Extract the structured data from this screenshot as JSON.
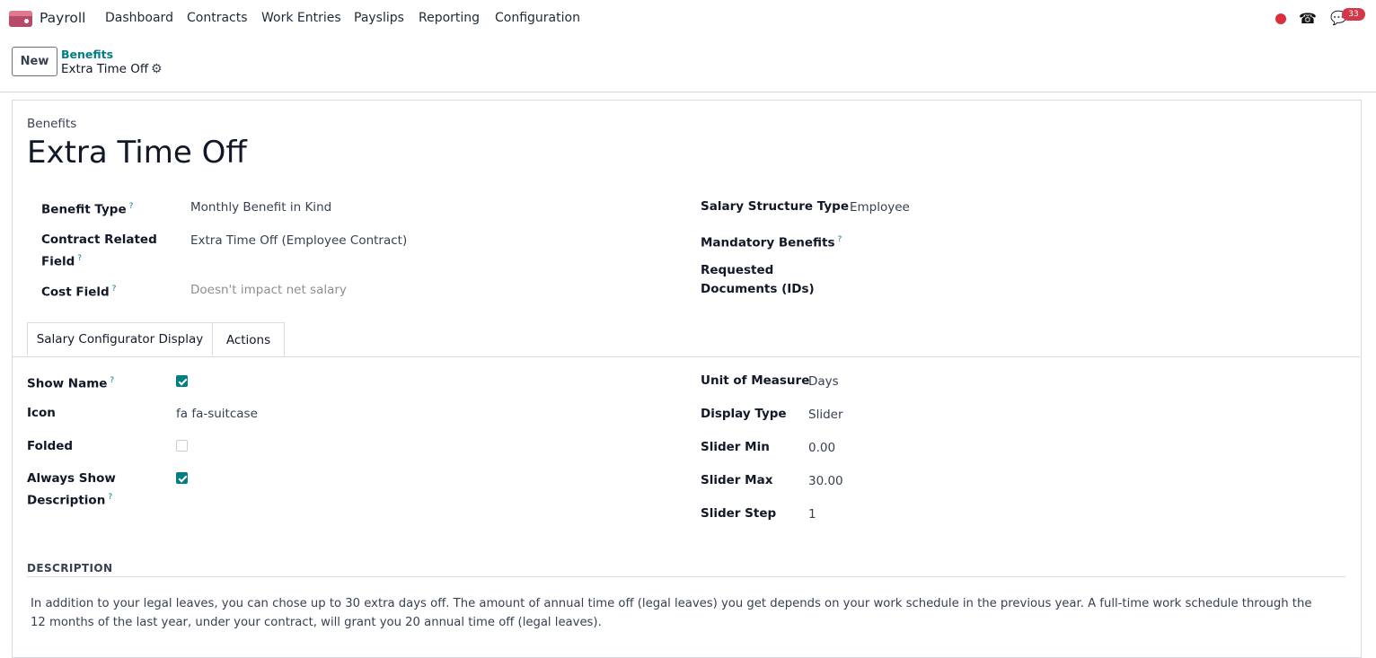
{
  "nav": {
    "app_name": "Payroll",
    "menu": [
      "Dashboard",
      "Contracts",
      "Work Entries",
      "Payslips",
      "Reporting",
      "Configuration"
    ],
    "notification_count": "33",
    "icons": [
      "recording-dot-icon",
      "phone-icon",
      "chat-icon"
    ]
  },
  "control_panel": {
    "new_label": "New",
    "breadcrumb_parent": "Benefits",
    "breadcrumb_current": "Extra Time Off"
  },
  "form": {
    "section_label": "Benefits",
    "title": "Extra Time Off",
    "left_fields": [
      {
        "label": "Benefit Type",
        "value": "Monthly Benefit in Kind"
      },
      {
        "label": "Contract Related Field",
        "value": "Extra Time Off (Employee Contract)"
      },
      {
        "label": "Cost Field",
        "value": "Doesn't impact net salary"
      }
    ],
    "right_fields": [
      {
        "label": "Salary Structure Type",
        "value": "Employee"
      },
      {
        "label": "Mandatory Benefits",
        "value": ""
      },
      {
        "label": "Requested Documents (IDs)",
        "value": ""
      }
    ]
  },
  "tabs": [
    "Salary Configurator Display",
    "Actions"
  ],
  "config": {
    "left": [
      {
        "label": "Show Name",
        "type": "checkbox",
        "checked": true
      },
      {
        "label": "Icon",
        "type": "text",
        "value": "fa fa-suitcase"
      },
      {
        "label": "Folded",
        "type": "checkbox",
        "checked": false
      },
      {
        "label": "Always Show Description",
        "type": "checkbox",
        "checked": true
      }
    ],
    "right": [
      {
        "label": "Unit of Measure",
        "value": "Days"
      },
      {
        "label": "Display Type",
        "value": "Slider"
      },
      {
        "label": "Slider Min",
        "value": "0.00"
      },
      {
        "label": "Slider Max",
        "value": "30.00"
      },
      {
        "label": "Slider Step",
        "value": "1"
      }
    ]
  },
  "description": {
    "title": "DESCRIPTION",
    "text": "In addition to your legal leaves, you can chose up to 30 extra days off. The amount of annual time off (legal leaves) you get depends on your work schedule in the previous year. A full-time work schedule through the 12 months of the last year, under your contract, will grant you 20 annual time off (legal leaves)."
  },
  "colors": {
    "accent": "#017e84",
    "app": "#b74a6a",
    "badge": "#d33848"
  }
}
